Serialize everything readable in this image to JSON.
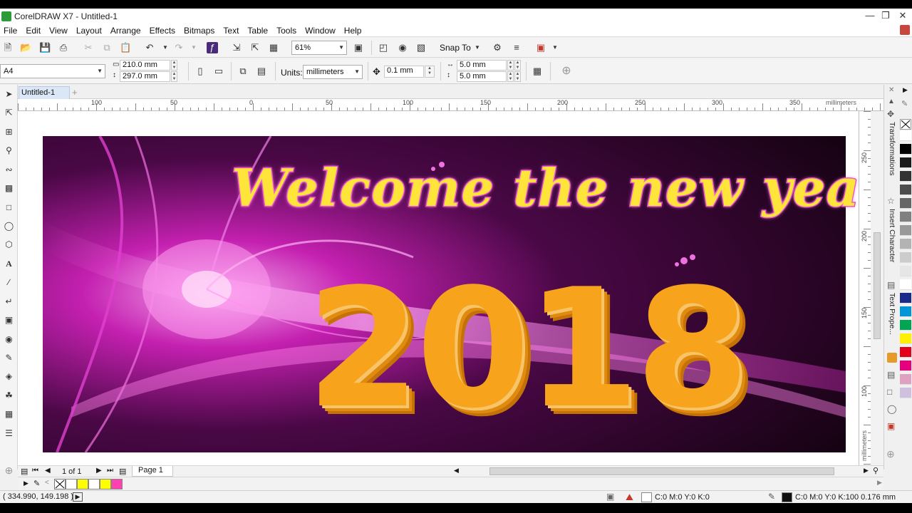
{
  "window": {
    "title": "CorelDRAW X7 - Untitled-1"
  },
  "menu": [
    "File",
    "Edit",
    "View",
    "Layout",
    "Arrange",
    "Effects",
    "Bitmaps",
    "Text",
    "Table",
    "Tools",
    "Window",
    "Help"
  ],
  "standard_toolbar": {
    "zoom": "61%",
    "snap_to": "Snap To"
  },
  "property_bar": {
    "page_size": "A4",
    "width": "210.0 mm",
    "height": "297.0 mm",
    "units_label": "Units:",
    "units": "millimeters",
    "nudge": "0.1 mm",
    "dup_x": "5.0 mm",
    "dup_y": "5.0 mm"
  },
  "document_tab": "Untitled-1",
  "ruler": {
    "h_ticks": [
      "100",
      "50",
      "0",
      "50",
      "100",
      "150",
      "200",
      "250",
      "300",
      "350"
    ],
    "h_unit": "millimeters",
    "v_ticks": [
      "250",
      "200",
      "150",
      "100"
    ],
    "v_unit": "millimeters"
  },
  "artwork": {
    "headline": "Welcome the new year",
    "year": "2018"
  },
  "dockers": [
    "Transformations",
    "Insert Character",
    "Text Prope..."
  ],
  "page_nav": {
    "counter": "1 of 1",
    "page_tab": "Page 1"
  },
  "status": {
    "coords": "( 334.990, 149.198 )",
    "fill": "C:0 M:0 Y:0 K:0",
    "outline": "C:0 M:0 Y:0 K:100  0.176 mm"
  },
  "colors": {
    "accent_blue": "#3a73c8",
    "headline_yellow": "#ffe53a",
    "headline_outline": "#e040c0",
    "year_orange": "#f7a41c",
    "bg_dark": "#1a0420",
    "magenta": "#e030c8"
  },
  "document_palette": [
    "#ffffff",
    "#ffff00",
    "#ffffff",
    "#ffff00",
    "#ff40b0"
  ],
  "palette_swatches": [
    "#ffffff",
    "#000000",
    "#1a1a1a",
    "#333333",
    "#4d4d4d",
    "#666666",
    "#808080",
    "#999999",
    "#b3b3b3",
    "#cccccc",
    "#e6e6e6",
    "#ffffff",
    "#1a2a8c",
    "#0094d9",
    "#00a651",
    "#ffef00",
    "#e2001a",
    "#e6007e",
    "#e0a0c0",
    "#d0c0e0"
  ]
}
